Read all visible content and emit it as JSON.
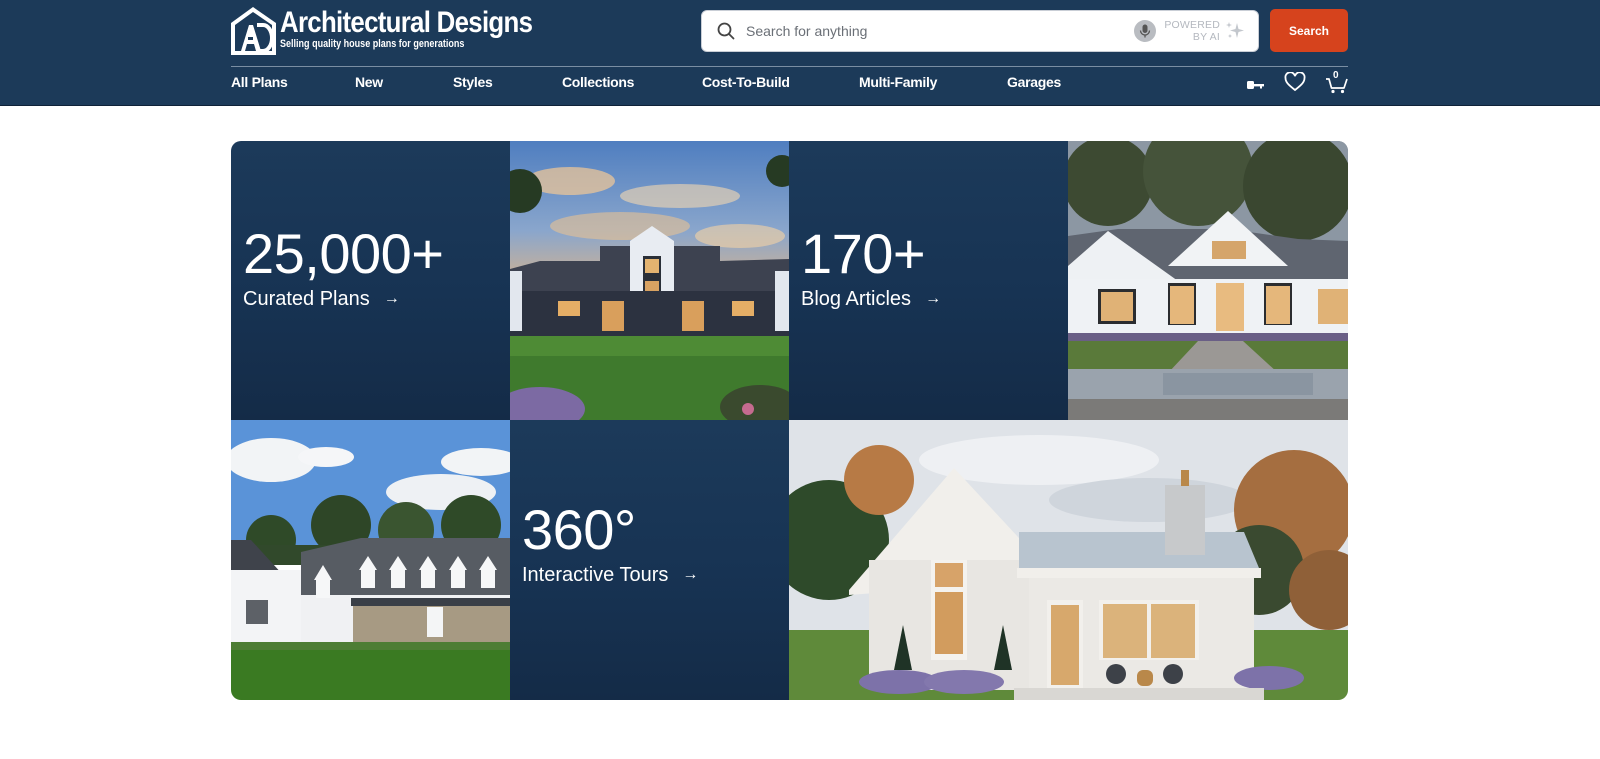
{
  "brand": {
    "name": "Architectural Designs",
    "tagline": "Selling quality house plans for generations",
    "logo_monogram": "AD"
  },
  "search": {
    "placeholder": "Search for anything",
    "value": "",
    "powered_line1": "POWERED",
    "powered_line2": "BY AI",
    "button_label": "Search",
    "icons": [
      "search-icon",
      "microphone-icon",
      "sparkle-icon"
    ]
  },
  "nav": {
    "items": [
      {
        "label": "All Plans"
      },
      {
        "label": "New"
      },
      {
        "label": "Styles"
      },
      {
        "label": "Collections"
      },
      {
        "label": "Cost-To-Build"
      },
      {
        "label": "Multi-Family"
      },
      {
        "label": "Garages"
      }
    ],
    "icons": [
      "key-icon",
      "heart-icon",
      "cart-icon"
    ],
    "cart_count": "0"
  },
  "tiles": {
    "plans": {
      "number": "25,000+",
      "label": "Curated Plans",
      "arrow": "→"
    },
    "blog": {
      "number": "170+",
      "label": "Blog Articles",
      "arrow": "→"
    },
    "tours": {
      "number": "360°",
      "label": "Interactive Tours",
      "arrow": "→"
    },
    "photos": [
      {
        "subject": "dark-roof modern farmhouse at sunset"
      },
      {
        "subject": "white board-and-batten farmhouse with stone steps"
      },
      {
        "subject": "white colonial house with dormers and stone porch"
      },
      {
        "subject": "shingle cottage with metal roof and porch"
      }
    ]
  },
  "colors": {
    "header_bg": "#1c3a59",
    "accent": "#d6431d",
    "tile_bg": "#1a3757"
  }
}
